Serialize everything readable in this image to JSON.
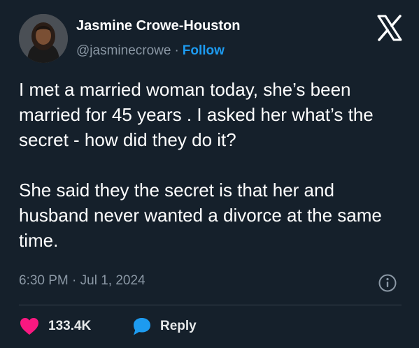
{
  "author": {
    "name": "Jasmine Crowe-Houston",
    "handle": "@jasminecrowe",
    "separator": "·",
    "follow_label": "Follow"
  },
  "tweet": {
    "paragraphs": [
      "I met a married woman today, she’s been married for 45 years . I asked her what’s the secret - how did they do it?",
      "She said they the secret is that her and husband never wanted a divorce at the same time."
    ],
    "timestamp": "6:30 PM · Jul 1, 2024"
  },
  "actions": {
    "like_count": "133.4K",
    "reply_label": "Reply"
  },
  "colors": {
    "background": "#15202b",
    "accent": "#1d9bf0",
    "like": "#f91880",
    "muted": "#8b98a5"
  },
  "icons": {
    "brand": "x-logo-icon",
    "info": "info-icon",
    "like": "heart-icon",
    "reply": "speech-bubble-icon"
  }
}
